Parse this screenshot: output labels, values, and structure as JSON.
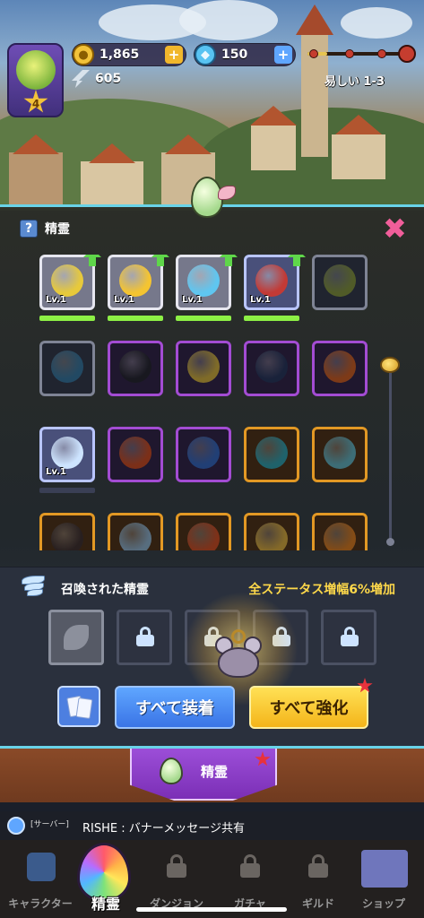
{
  "hud": {
    "player_level": "4",
    "coins": "1,865",
    "gems": "150",
    "energy": "605",
    "stage": "易しい 1-3",
    "stage_progress": 0.2,
    "plus": "+"
  },
  "panel": {
    "help": "?",
    "title": "精霊",
    "close": "✖"
  },
  "spirits": [
    {
      "level": "Lv.1",
      "color": "#e7c93b",
      "upgrade": true,
      "bar": 1.0
    },
    {
      "level": "Lv.1",
      "color": "#f4c431",
      "upgrade": true,
      "bar": 1.0
    },
    {
      "level": "Lv.1",
      "color": "#5fc6f0",
      "upgrade": true,
      "bar": 1.0
    },
    {
      "level": "Lv.1",
      "color": "#c33a35",
      "upgrade": true,
      "bar": 1.0
    },
    {
      "level": "",
      "color": "#93a64a",
      "upgrade": false,
      "bar": null
    },
    {
      "level": "",
      "color": "#3f86b5",
      "upgrade": false,
      "bar": null
    },
    {
      "level": "",
      "color": "#2c2c3a",
      "upgrade": false,
      "bar": null
    },
    {
      "level": "",
      "color": "#e8c44a",
      "upgrade": false,
      "bar": null
    },
    {
      "level": "",
      "color": "#2f3e6a",
      "upgrade": false,
      "bar": null
    },
    {
      "level": "",
      "color": "#e46b2c",
      "upgrade": false,
      "bar": null
    },
    {
      "level": "Lv.1",
      "color": "#cde4ff",
      "upgrade": false,
      "bar": 0.0
    },
    {
      "level": "",
      "color": "#e1572d",
      "upgrade": false,
      "bar": null
    },
    {
      "level": "",
      "color": "#3c73d6",
      "upgrade": false,
      "bar": null
    },
    {
      "level": "",
      "color": "#3ab3c4",
      "upgrade": false,
      "bar": null
    },
    {
      "level": "",
      "color": "#6fc7d8",
      "upgrade": false,
      "bar": null
    },
    {
      "level": "",
      "color": "#4a3a3a",
      "upgrade": false,
      "bar": null
    },
    {
      "level": "",
      "color": "#9fc6e6",
      "upgrade": false,
      "bar": null
    },
    {
      "level": "",
      "color": "#e5592d",
      "upgrade": false,
      "bar": null
    },
    {
      "level": "",
      "color": "#f1c04a",
      "upgrade": false,
      "bar": null
    },
    {
      "level": "",
      "color": "#f08a28",
      "upgrade": false,
      "bar": null
    }
  ],
  "summoned": {
    "title": "召喚された精霊",
    "bonus": "全ステータス増幅6%増加"
  },
  "actions": {
    "equip_all": "すべて装着",
    "upgrade_all": "すべて強化"
  },
  "tab": {
    "active_label": "精霊"
  },
  "banner": {
    "tag": "[サーバー]",
    "message": "RISHE : バナーメッセージ共有"
  },
  "nav": {
    "items": [
      "キャラクター",
      "精霊",
      "ダンジョン",
      "ガチャ",
      "ギルド",
      "ショップ"
    ]
  }
}
